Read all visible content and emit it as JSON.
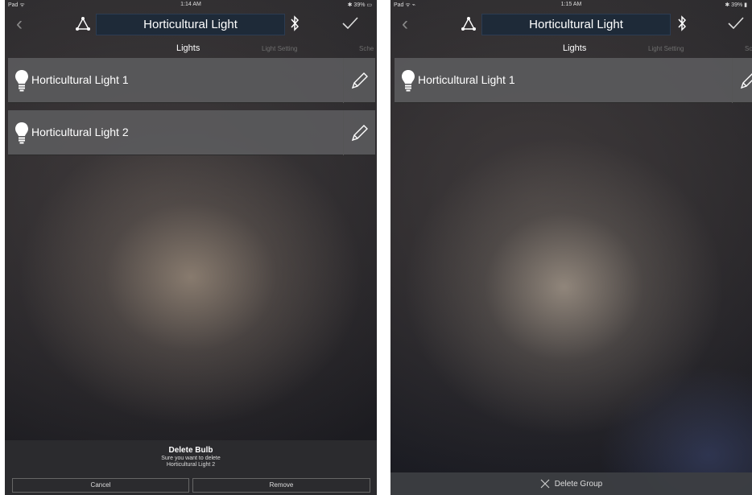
{
  "left": {
    "status": {
      "carrier": "Pad ᯤ",
      "time": "1:14 AM",
      "battery": "✱ 39% ▭"
    },
    "nav": {
      "back": "‹",
      "title": "Horticultural Light"
    },
    "tabs": [
      "Lights",
      "Light Setting",
      "Sche"
    ],
    "lights": [
      "Horticultural Light 1",
      "Horticultural Light 2"
    ],
    "dialog": {
      "title": "Delete Bulb",
      "message_line1": "Sure you want to delete",
      "message_line2": "Horticultural Light 2",
      "cancel": "Cancel",
      "remove": "Remove"
    }
  },
  "right": {
    "status": {
      "carrier": "Pad ᯤ ⌁",
      "time": "1:15 AM",
      "battery": "✱ 39% ▮"
    },
    "nav": {
      "back": "‹",
      "title": "Horticultural Light"
    },
    "tabs": [
      "Lights",
      "Light Setting",
      "Sc"
    ],
    "lights": [
      "Horticultural Light 1"
    ],
    "delete_group": "Delete Group"
  },
  "colors": {
    "row_bg": "#5c5c5e",
    "title_field_bg": "#1e2a38",
    "background": "#242327"
  }
}
